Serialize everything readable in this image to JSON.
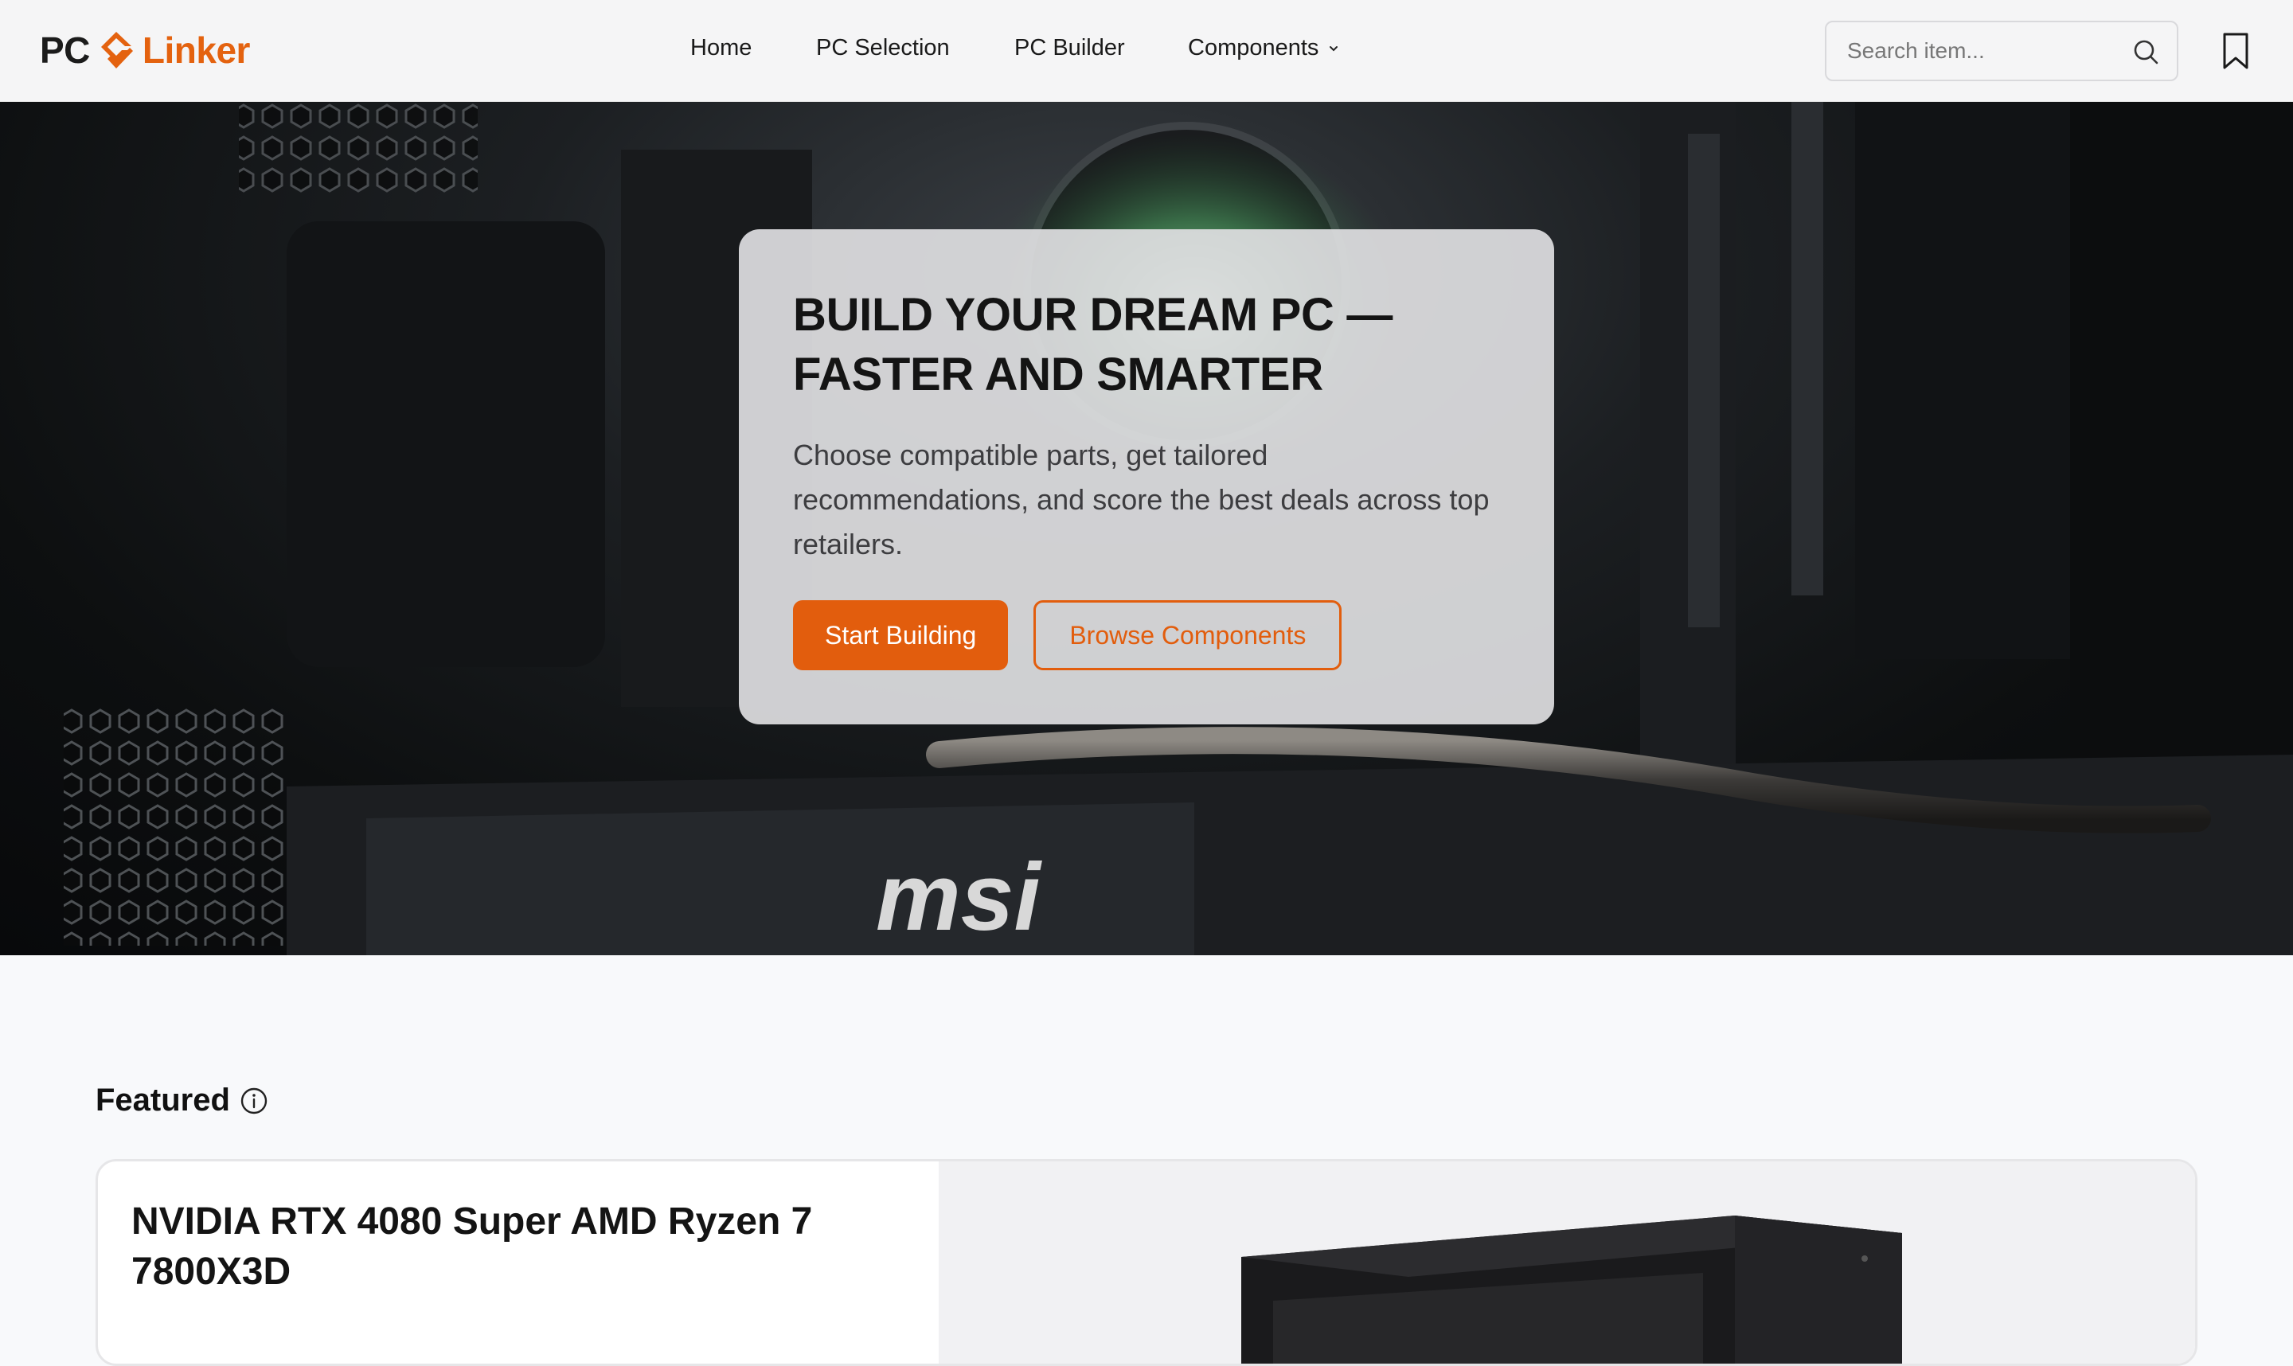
{
  "header": {
    "logo": {
      "left": "PC",
      "right": "Linker"
    },
    "nav": [
      {
        "label": "Home"
      },
      {
        "label": "PC Selection"
      },
      {
        "label": "PC Builder"
      },
      {
        "label": "Components",
        "has_dropdown": true
      }
    ],
    "search": {
      "placeholder": "Search item...",
      "value": ""
    },
    "bookmark_icon": "bookmark-icon"
  },
  "hero": {
    "title_line1": "BUILD YOUR DREAM PC —",
    "title_line2": "FASTER AND SMARTER",
    "subtitle": "Choose compatible parts, get tailored recommendations, and score the best deals across top retailers.",
    "primary_button": "Start Building",
    "secondary_button": "Browse Components",
    "background_brand": "msi"
  },
  "featured": {
    "title": "Featured",
    "info_icon": "info-icon",
    "item": {
      "name": "NVIDIA RTX 4080 Super AMD Ryzen 7 7800X3D"
    }
  },
  "colors": {
    "accent": "#e25d0d",
    "header_bg": "#f5f5f6",
    "page_bg": "#f8f9fb"
  }
}
